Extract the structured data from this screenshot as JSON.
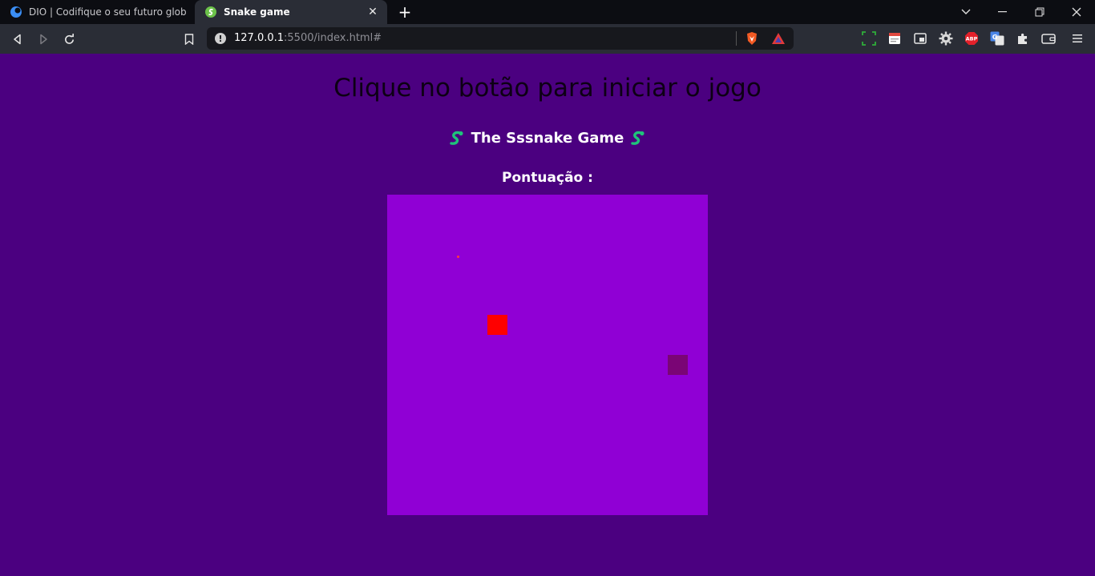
{
  "browser": {
    "tabs": [
      {
        "title": "DIO | Codifique o seu futuro global ag",
        "active": false
      },
      {
        "title": "Snake game",
        "active": true
      }
    ],
    "address": {
      "host": "127.0.0.1",
      "rest": ":5500/index.html#"
    }
  },
  "page": {
    "heading": "Clique no botão para iniciar o jogo",
    "game_title": "The Sssnake Game",
    "score_label": "Pontuação :"
  },
  "colors": {
    "page_bg": "#4b0080",
    "board_bg": "#9000d5",
    "food": "#ff0000",
    "snake": "#7a0575",
    "snake_emoji": "#1fc37a"
  }
}
